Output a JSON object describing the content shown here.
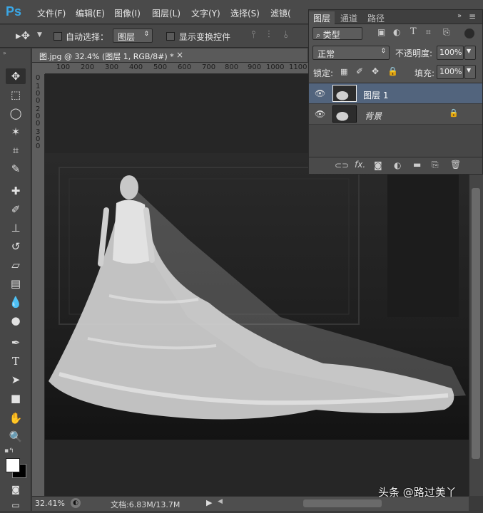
{
  "app": {
    "logo": "Ps"
  },
  "menu": [
    "文件(F)",
    "编辑(E)",
    "图像(I)",
    "图层(L)",
    "文字(Y)",
    "选择(S)",
    "滤镜("
  ],
  "options": {
    "auto_select_label": "自动选择：",
    "auto_select_value": "图层",
    "transform_label": "显示变换控件"
  },
  "document": {
    "tab_title": "图.jpg @ 32.4% (图层 1, RGB/8#) *",
    "close": "×",
    "ruler_h": [
      "100",
      "200",
      "300",
      "400",
      "500",
      "600",
      "700",
      "800",
      "900",
      "1000",
      "1100"
    ],
    "ruler_v": [
      "0",
      "1",
      "0",
      "0",
      "2",
      "0",
      "0",
      "3",
      "0",
      "0"
    ]
  },
  "status": {
    "zoom": "32.41%",
    "doc_info": "文档:6.83M/13.7M"
  },
  "layers_panel": {
    "tabs": [
      "图层",
      "通道",
      "路径"
    ],
    "filter_label": "类型",
    "blend_mode": "正常",
    "opacity_label": "不透明度:",
    "opacity_value": "100%",
    "lock_label": "锁定:",
    "fill_label": "填充:",
    "fill_value": "100%",
    "layers": [
      {
        "name": "图层 1",
        "selected": true
      },
      {
        "name": "背景",
        "selected": false,
        "locked": true
      }
    ]
  },
  "watermark": "头条 @路过美丫",
  "colors": {
    "accent": "#3aa7e6",
    "selected_layer": "#52647d"
  }
}
